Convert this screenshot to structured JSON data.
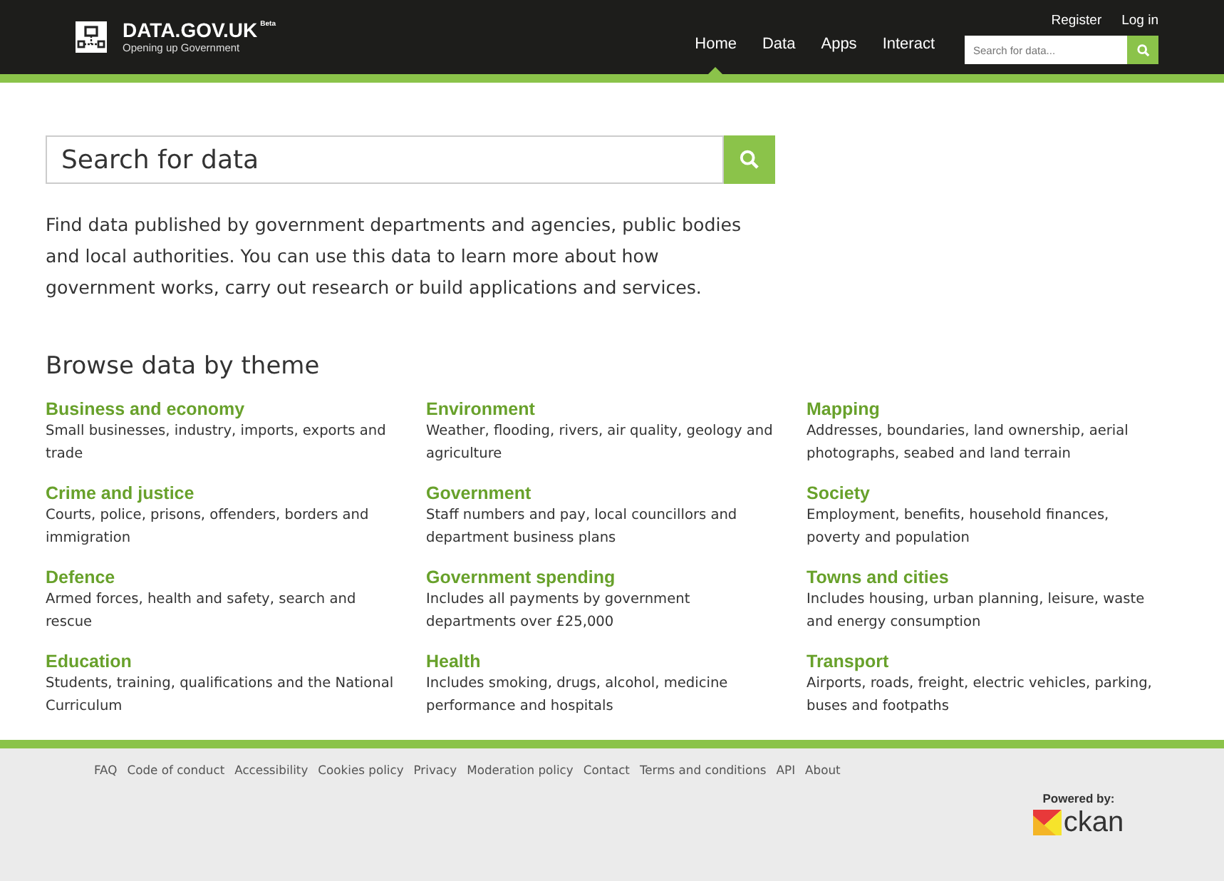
{
  "header": {
    "logo_title": "DATA.GOV.UK",
    "logo_badge": "Beta",
    "logo_subtitle": "Opening up Government",
    "account_links": [
      "Register",
      "Log in"
    ],
    "nav": [
      {
        "label": "Home",
        "selected": true
      },
      {
        "label": "Data",
        "selected": false
      },
      {
        "label": "Apps",
        "selected": false
      },
      {
        "label": "Interact",
        "selected": false
      }
    ],
    "search": {
      "placeholder": "Search for data..."
    }
  },
  "search": {
    "placeholder": "Search for data"
  },
  "intro": "Find data published by government departments and agencies, public bodies and local authorities. You can use this data to learn more about how government works, carry out research or build applications and services.",
  "browse": {
    "title": "Browse data by theme",
    "themes": [
      {
        "title": "Business and economy",
        "description": "Small businesses, industry, imports, exports and trade"
      },
      {
        "title": "Environment",
        "description": "Weather, flooding, rivers, air quality, geology and agriculture"
      },
      {
        "title": "Mapping",
        "description": "Addresses, boundaries, land ownership, aerial photographs, seabed and land terrain"
      },
      {
        "title": "Crime and justice",
        "description": "Courts, police, prisons, offenders, borders and immigration"
      },
      {
        "title": "Government",
        "description": "Staff numbers and pay, local councillors and department business plans"
      },
      {
        "title": "Society",
        "description": "Employment, benefits, household finances, poverty and population"
      },
      {
        "title": "Defence",
        "description": "Armed forces, health and safety, search and rescue"
      },
      {
        "title": "Government spending",
        "description": "Includes all payments by government departments over £25,000"
      },
      {
        "title": "Towns and cities",
        "description": "Includes housing, urban planning, leisure, waste and energy consumption"
      },
      {
        "title": "Education",
        "description": "Students, training, qualifications and the National Curriculum"
      },
      {
        "title": "Health",
        "description": "Includes smoking, drugs, alcohol, medicine performance and hospitals"
      },
      {
        "title": "Transport",
        "description": "Airports, roads, freight, electric vehicles, parking, buses and footpaths"
      }
    ]
  },
  "footer": {
    "links": [
      "FAQ",
      "Code of conduct",
      "Accessibility",
      "Cookies policy",
      "Privacy",
      "Moderation policy",
      "Contact",
      "Terms and conditions",
      "API",
      "About"
    ],
    "powered_by": "Powered by:",
    "ckan_logo": "ckan"
  }
}
